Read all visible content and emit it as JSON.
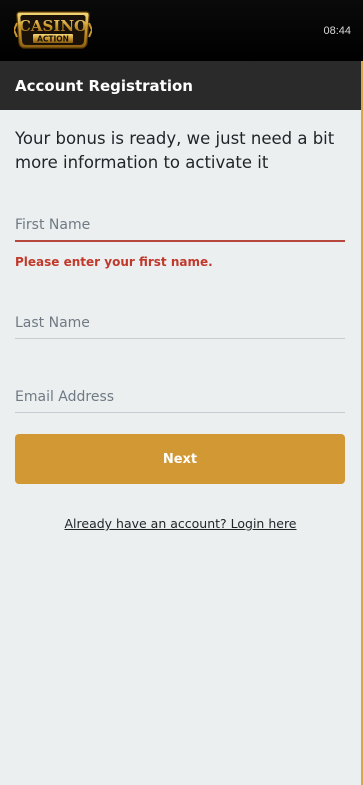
{
  "brand": {
    "logo_line1": "CASINO",
    "logo_line2": "ACTION",
    "colors": {
      "gold": "#d29834",
      "header": "#2a2a2a",
      "error": "#c0392b"
    }
  },
  "status": {
    "time": "08:44"
  },
  "header": {
    "title": "Account Registration"
  },
  "form": {
    "intro": "Your bonus is ready, we just need a bit more information to activate it",
    "first_name": {
      "placeholder": "First Name",
      "value": "",
      "error": "Please enter your first name."
    },
    "last_name": {
      "placeholder": "Last Name",
      "value": ""
    },
    "email": {
      "placeholder": "Email Address",
      "value": ""
    },
    "next_label": "Next",
    "login_link": "Already have an account? Login here"
  }
}
